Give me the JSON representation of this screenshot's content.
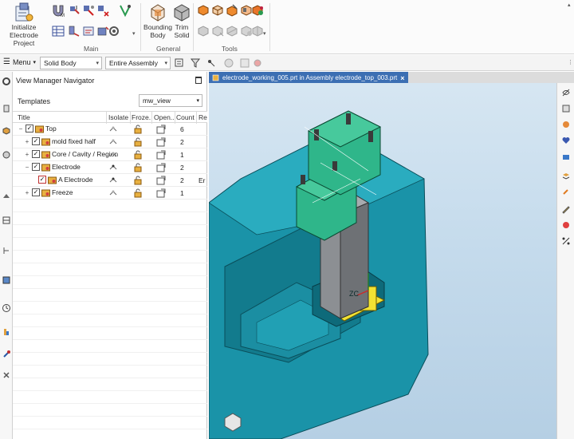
{
  "ribbon": {
    "initialize": {
      "line1": "Initialize",
      "line2": "Electrode Project"
    },
    "main_label": "Main",
    "bounding": {
      "line1": "Bounding",
      "line2": "Body"
    },
    "trim": {
      "line1": "Trim",
      "line2": "Solid"
    },
    "general_label": "General",
    "tools_label": "Tools"
  },
  "toolbar": {
    "menu_label": "Menu",
    "type_filter": "Solid Body",
    "scope_filter": "Entire Assembly"
  },
  "navigator": {
    "title": "View Manager Navigator",
    "templates_label": "Templates",
    "template_value": "mw_view",
    "columns": [
      "Title",
      "Isolate",
      "Froze...",
      "Open...",
      "Count",
      "Re"
    ],
    "rows": [
      {
        "toggle": "−",
        "label": "Top",
        "count": "6",
        "re": ""
      },
      {
        "toggle": "+",
        "label": "mold fixed half",
        "count": "2",
        "re": ""
      },
      {
        "toggle": "+",
        "label": "Core / Cavity / Region",
        "count": "1",
        "re": ""
      },
      {
        "toggle": "−",
        "label": "Electrode",
        "count": "2",
        "re": ""
      },
      {
        "toggle": "",
        "label": "A Electrode",
        "count": "2",
        "re": "Er"
      },
      {
        "toggle": "+",
        "label": "Freeze",
        "count": "1",
        "re": ""
      }
    ]
  },
  "viewport": {
    "tab_title": "electrode_working_005.prt in Assembly electrode_top_003.prt",
    "tab_close": "×",
    "axis_label": "ZC",
    "bg_color": "#c5dbec",
    "mold_color": "#1a93a8",
    "electrode_color": "#2fb68a"
  }
}
